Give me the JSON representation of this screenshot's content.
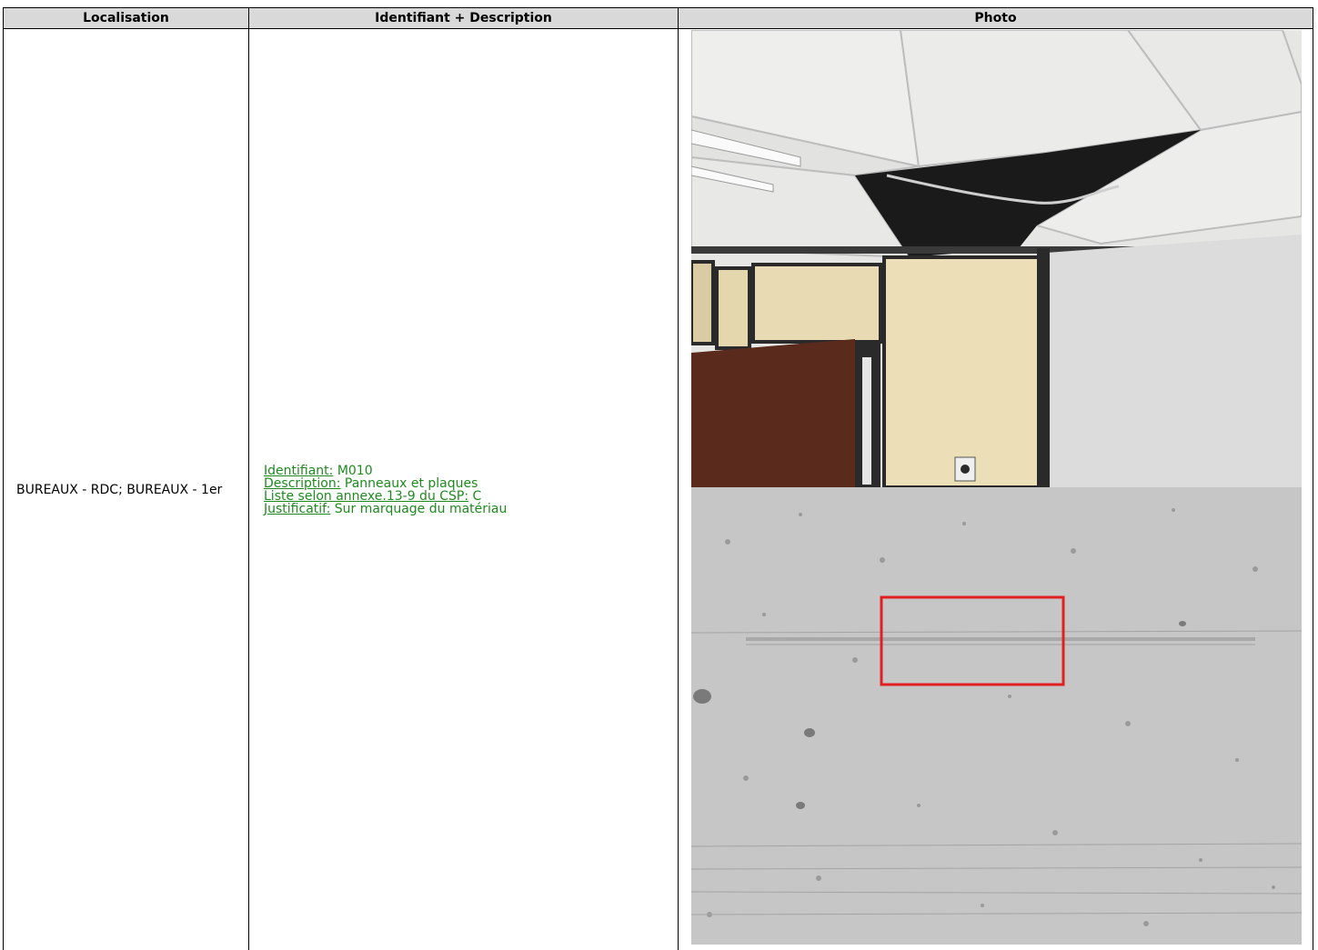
{
  "table": {
    "headers": [
      "Localisation",
      "Identifiant + Description",
      "Photo"
    ]
  },
  "row": {
    "localisation": "BUREAUX - RDC; BUREAUX - 1er",
    "identifiant_label": "Identifiant:",
    "identifiant_value": "M010",
    "description_label": "Description:",
    "description_value": "Panneaux et plaques",
    "liste_label": "Liste selon annexe.13-9 du CSP:",
    "liste_value": "C",
    "justificatif_label": "Justificatif:",
    "justificatif_value": "Sur marquage du matériau"
  },
  "colors": {
    "header_bg": "#d9d9d9",
    "link_green": "#1e8a1e",
    "highlight_red": "#e02020"
  }
}
